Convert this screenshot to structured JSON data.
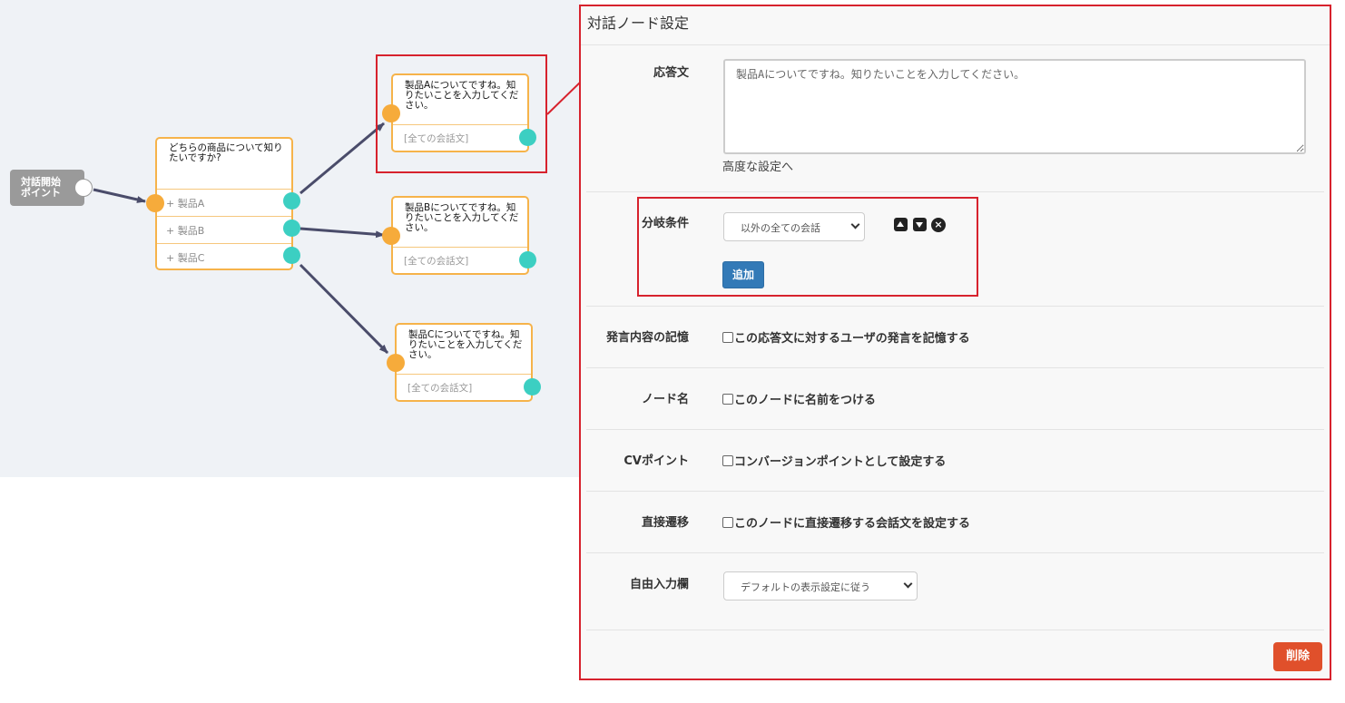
{
  "colors": {
    "accent_red": "#d7222d",
    "node_border": "#f6b34a",
    "input_port": "#f6ab3b",
    "output_port": "#3ccfc2",
    "edge": "#4a4c6a",
    "primary_button": "#337ab7",
    "danger_button": "#e0502b"
  },
  "canvas": {
    "start_node": {
      "line1": "対話開始",
      "line2": "ポイント"
    },
    "question_node": {
      "text": "どちらの商品について知りたいですか?",
      "branches": [
        "+ 製品A",
        "+ 製品B",
        "+ 製品C"
      ]
    },
    "answer_nodes": [
      {
        "text": "製品Aについてですね。知りたいことを入力してください。",
        "footer": "[全ての会話文]"
      },
      {
        "text": "製品Bについてですね。知りたいことを入力してください。",
        "footer": "[全ての会話文]"
      },
      {
        "text": "製品Cについてですね。知りたいことを入力してください。",
        "footer": "[全ての会話文]"
      }
    ]
  },
  "panel": {
    "title": "対話ノード設定",
    "response": {
      "label": "応答文",
      "value": "製品Aについてですね。知りたいことを入力してください。",
      "advanced_link": "高度な設定へ"
    },
    "branch": {
      "label": "分岐条件",
      "select_value": "以外の全ての会話",
      "add_button": "追加",
      "icons": [
        "move-up-icon",
        "move-down-icon",
        "remove-icon"
      ]
    },
    "memory": {
      "label": "発言内容の記憶",
      "checkbox": "この応答文に対するユーザの発言を記憶する"
    },
    "node_name": {
      "label": "ノード名",
      "checkbox": "このノードに名前をつける"
    },
    "cv_point": {
      "label": "CVポイント",
      "checkbox": "コンバージョンポイントとして設定する"
    },
    "direct": {
      "label": "直接遷移",
      "checkbox": "このノードに直接遷移する会話文を設定する"
    },
    "free_input": {
      "label": "自由入力欄",
      "select_value": "デフォルトの表示設定に従う"
    },
    "delete_button": "削除"
  }
}
